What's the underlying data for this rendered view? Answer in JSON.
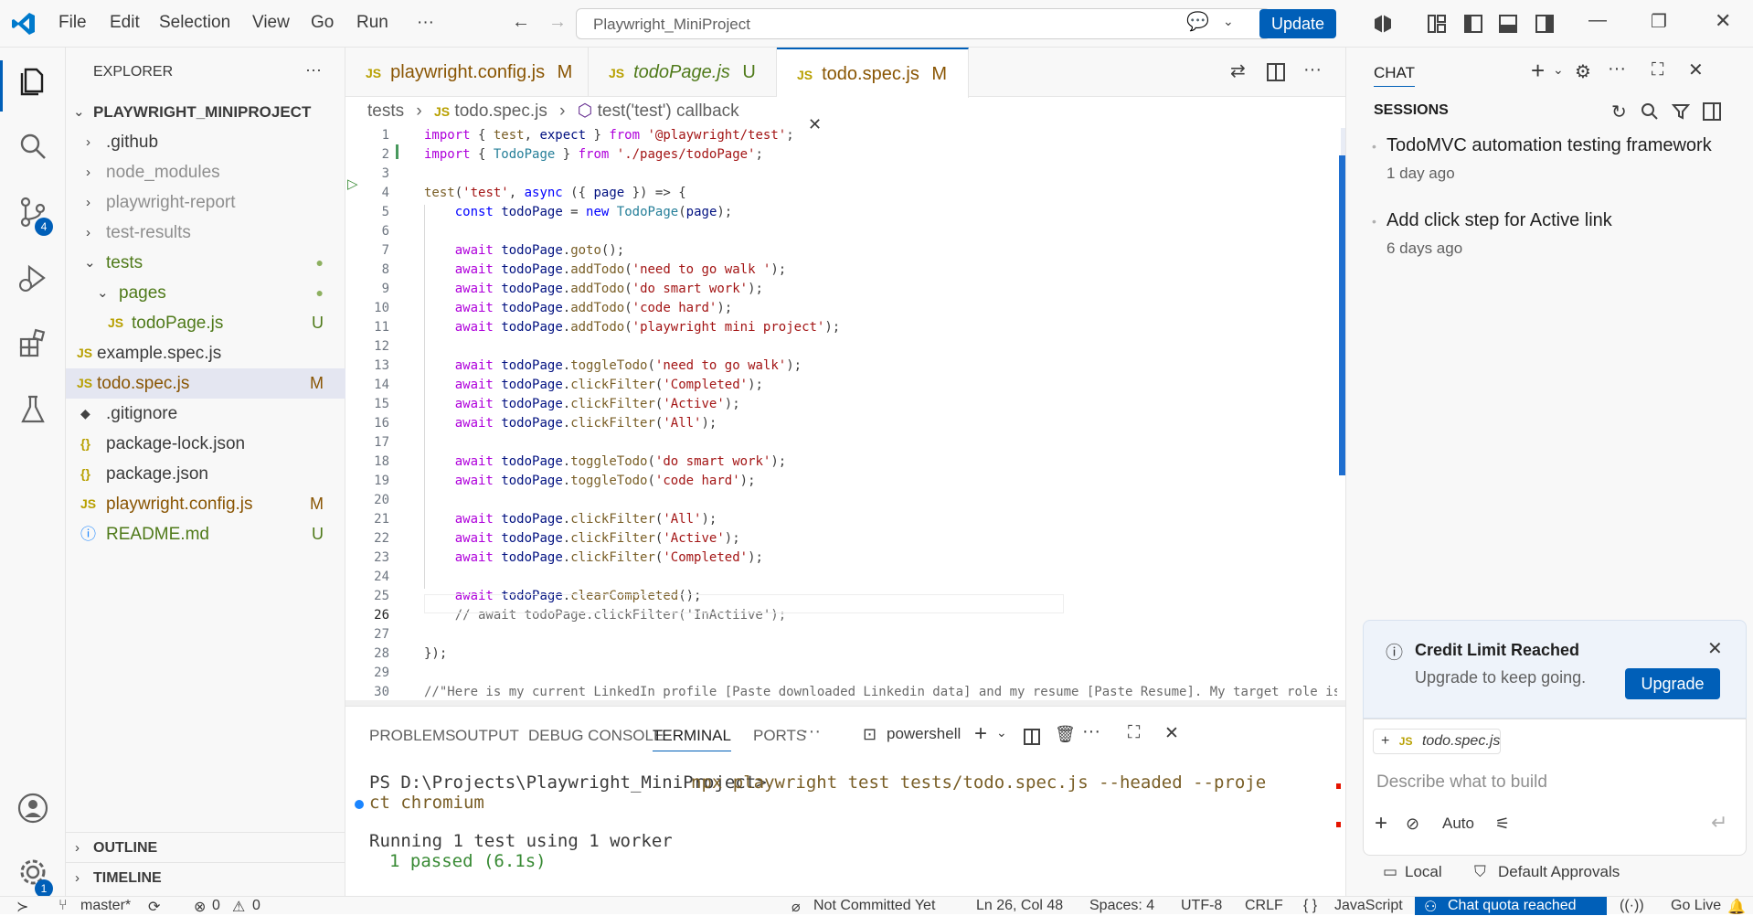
{
  "titlebar": {
    "menus": [
      "File",
      "Edit",
      "Selection",
      "View",
      "Go",
      "Run",
      "···"
    ],
    "search": "Playwright_MiniProject",
    "update": "Update"
  },
  "activity": {
    "scm_badge": "4",
    "settings_badge": "1"
  },
  "explorer": {
    "header": "EXPLORER",
    "root": "PLAYWRIGHT_MINIPROJECT",
    "items": [
      {
        "label": ".github",
        "status": ""
      },
      {
        "label": "node_modules",
        "status": ""
      },
      {
        "label": "playwright-report",
        "status": ""
      },
      {
        "label": "test-results",
        "status": ""
      },
      {
        "label": "tests",
        "status": "●"
      },
      {
        "label": "pages",
        "status": "●"
      },
      {
        "label": "todoPage.js",
        "status": "U"
      },
      {
        "label": "example.spec.js",
        "status": ""
      },
      {
        "label": "todo.spec.js",
        "status": "M"
      },
      {
        "label": ".gitignore",
        "status": ""
      },
      {
        "label": "package-lock.json",
        "status": ""
      },
      {
        "label": "package.json",
        "status": ""
      },
      {
        "label": "playwright.config.js",
        "status": "M"
      },
      {
        "label": "README.md",
        "status": "U"
      }
    ],
    "outline": "OUTLINE",
    "timeline": "TIMELINE"
  },
  "tabs": [
    {
      "label": "playwright.config.js",
      "status": "M"
    },
    {
      "label": "todoPage.js",
      "status": "U"
    },
    {
      "label": "todo.spec.js",
      "status": "M"
    }
  ],
  "breadcrumb": {
    "folder": "tests",
    "file": "todo.spec.js",
    "symbol": "test('test') callback"
  },
  "code": {
    "line_numbers": [
      "1",
      "2",
      "3",
      "4",
      "5",
      "6",
      "7",
      "8",
      "9",
      "10",
      "11",
      "12",
      "13",
      "14",
      "15",
      "16",
      "17",
      "18",
      "19",
      "20",
      "21",
      "22",
      "23",
      "24",
      "25",
      "26",
      "27",
      "28",
      "29",
      "30"
    ],
    "l1": "import { test, expect } from '@playwright/test';",
    "l2": "import { TodoPage } from './pages/todoPage';",
    "l4": "test('test', async ({ page }) => {",
    "l5": "    const todoPage = new TodoPage(page);",
    "l7": "    await todoPage.goto();",
    "l8": "    await todoPage.addTodo('need to go walk ');",
    "l9": "    await todoPage.addTodo('do smart work');",
    "l10": "    await todoPage.addTodo('code hard');",
    "l11": "    await todoPage.addTodo('playwright mini project');",
    "l13": "    await todoPage.toggleTodo('need to go walk');",
    "l14": "    await todoPage.clickFilter('Completed');",
    "l15": "    await todoPage.clickFilter('Active');",
    "l16": "    await todoPage.clickFilter('All');",
    "l18": "    await todoPage.toggleTodo('do smart work');",
    "l19": "    await todoPage.toggleTodo('code hard');",
    "l21": "    await todoPage.clickFilter('All');",
    "l22": "    await todoPage.clickFilter('Active');",
    "l23": "    await todoPage.clickFilter('Completed');",
    "l25": "    await todoPage.clearCompleted();",
    "l26": "    // await todoPage.clickFilter('InActiive');",
    "l28": "});",
    "l30": "//\"Here is my current LinkedIn profile [Paste downloaded Linkedin data] and my resume [Paste Resume]. My target role is"
  },
  "panel": {
    "tabs": [
      "PROBLEMS",
      "OUTPUT",
      "DEBUG CONSOLE",
      "TERMINAL",
      "PORTS",
      "···"
    ],
    "shell": "powershell",
    "prompt": "PS D:\\Projects\\Playwright_MiniProject>",
    "command": "npx playwright test tests/todo.spec.js --headed --proje",
    "command_cont": "ct chromium",
    "running": "Running 1 test using 1 worker",
    "passed": "1 passed (6.1s)"
  },
  "chat": {
    "header": "CHAT",
    "sessions_header": "SESSIONS",
    "sessions": [
      {
        "title": "TodoMVC automation testing framework",
        "time": "1 day ago"
      },
      {
        "title": "Add click step for Active link",
        "time": "6 days ago"
      }
    ],
    "credit_title": "Credit Limit Reached",
    "credit_sub": "Upgrade to keep going.",
    "upgrade": "Upgrade",
    "context_file": "todo.spec.js",
    "input_placeholder": "Describe what to build",
    "mode": "Auto",
    "local": "Local",
    "approvals": "Default Approvals"
  },
  "status": {
    "branch": "master*",
    "errors": "0",
    "warnings": "0",
    "commit": "Not Committed Yet",
    "position": "Ln 26, Col 48",
    "spaces": "Spaces: 4",
    "encoding": "UTF-8",
    "eol": "CRLF",
    "language": "JavaScript",
    "quota": "Chat quota reached",
    "golive": "Go Live"
  }
}
